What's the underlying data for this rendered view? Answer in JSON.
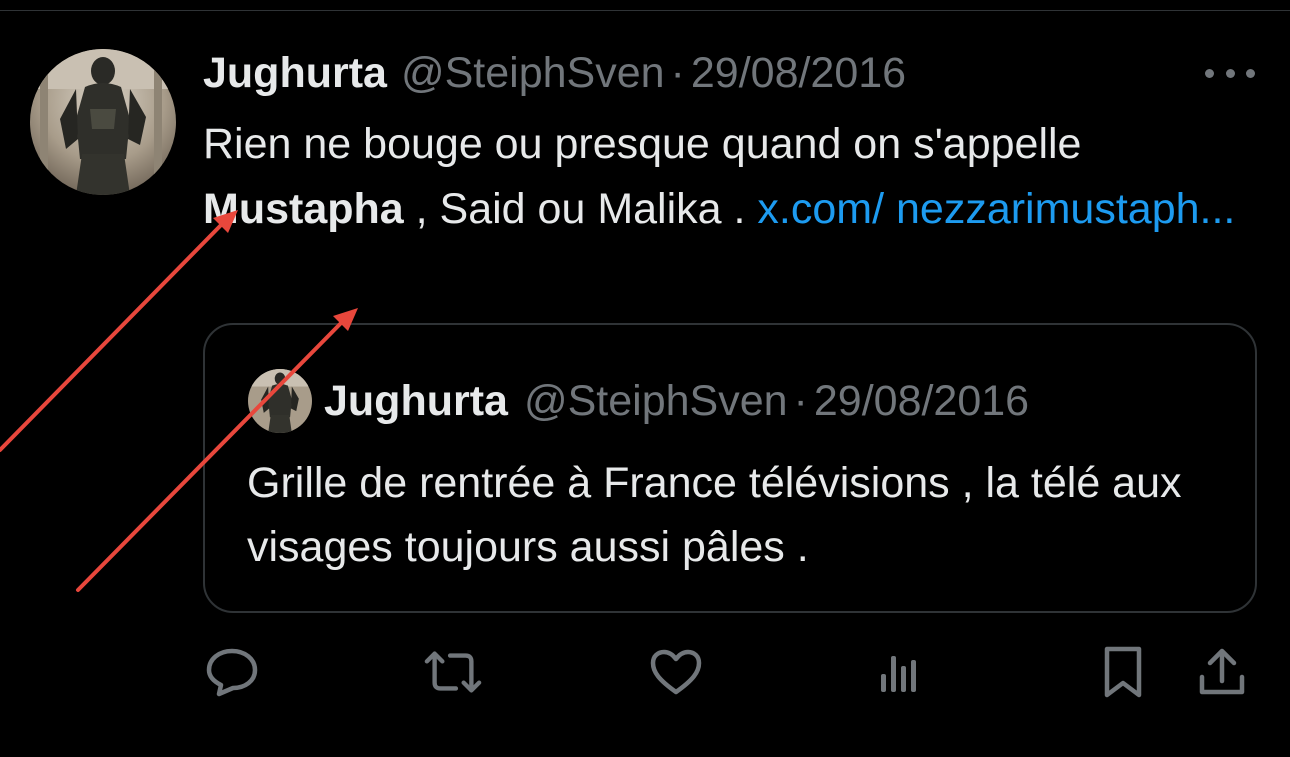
{
  "tweet": {
    "author_name": "Jughurta",
    "handle": "@SteiphSven",
    "separator": "·",
    "date": "29/08/2016",
    "text_part1": "Rien ne bouge ou presque quand on s'appelle ",
    "text_bold": "Mustapha",
    "text_part2": " , Said ou Malika . ",
    "link_text": "x.com/ nezzarimustaph..."
  },
  "quoted": {
    "author_name": "Jughurta",
    "handle": "@SteiphSven",
    "separator": "·",
    "date": "29/08/2016",
    "text": "Grille de rentrée à France télévisions , la télé aux visages toujours aussi pâles ."
  },
  "icons": {
    "avatar": "statue-avatar",
    "more": "more-options-icon",
    "reply": "reply-icon",
    "retweet": "retweet-icon",
    "like": "heart-icon",
    "views": "views-icon",
    "bookmark": "bookmark-icon",
    "share": "share-icon"
  },
  "colors": {
    "background": "#000000",
    "text": "#e7e9ea",
    "muted": "#71767b",
    "link": "#1d9bf0",
    "border": "#2f3336",
    "annotation_arrow": "#e8473c"
  }
}
